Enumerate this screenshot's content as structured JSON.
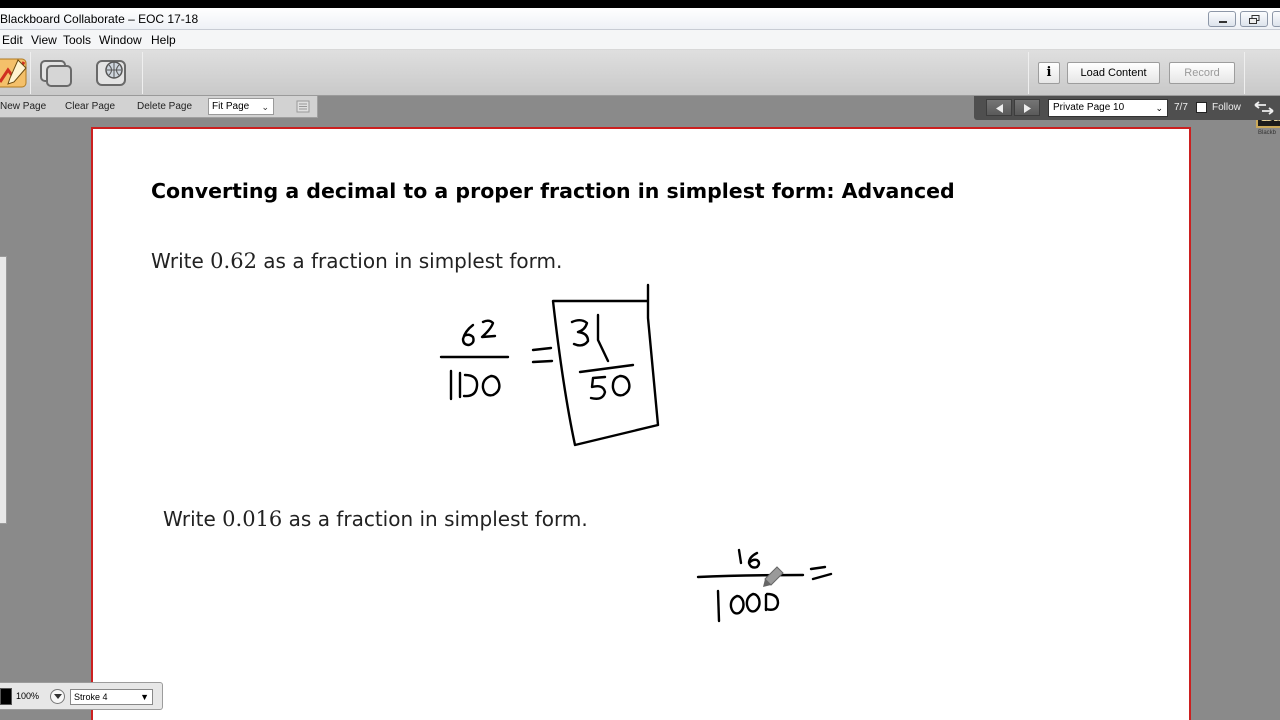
{
  "window": {
    "title": "Blackboard Collaborate – EOC 17-18"
  },
  "menu": [
    "Edit",
    "View",
    "Tools",
    "Window",
    "Help"
  ],
  "toolbar": {
    "info_label": "i",
    "load_content_label": "Load Content",
    "record_label": "Record",
    "logo_text": "Bb",
    "logo_caption": "Blackb"
  },
  "subtoolbar": {
    "new_page": "New Page",
    "clear_page": "Clear Page",
    "delete_page": "Delete Page",
    "fit_page": "Fit Page"
  },
  "navigation": {
    "current_page": "Private Page 10",
    "page_count": "7/7",
    "follow_label": "Follow"
  },
  "whiteboard": {
    "heading": "Converting a decimal to a proper fraction in simplest form: Advanced",
    "question1": {
      "prefix": "Write ",
      "number": "0.62",
      "suffix": " as a fraction in simplest form."
    },
    "question2": {
      "prefix": "Write ",
      "number": "0.016",
      "suffix": " as a fraction in simplest form."
    }
  },
  "drawing_options": {
    "color": "#000000",
    "zoom": "100%",
    "stroke": "Stroke 4"
  },
  "colors": {
    "board_border": "#cc2020",
    "app_background": "#8a8a8a"
  }
}
